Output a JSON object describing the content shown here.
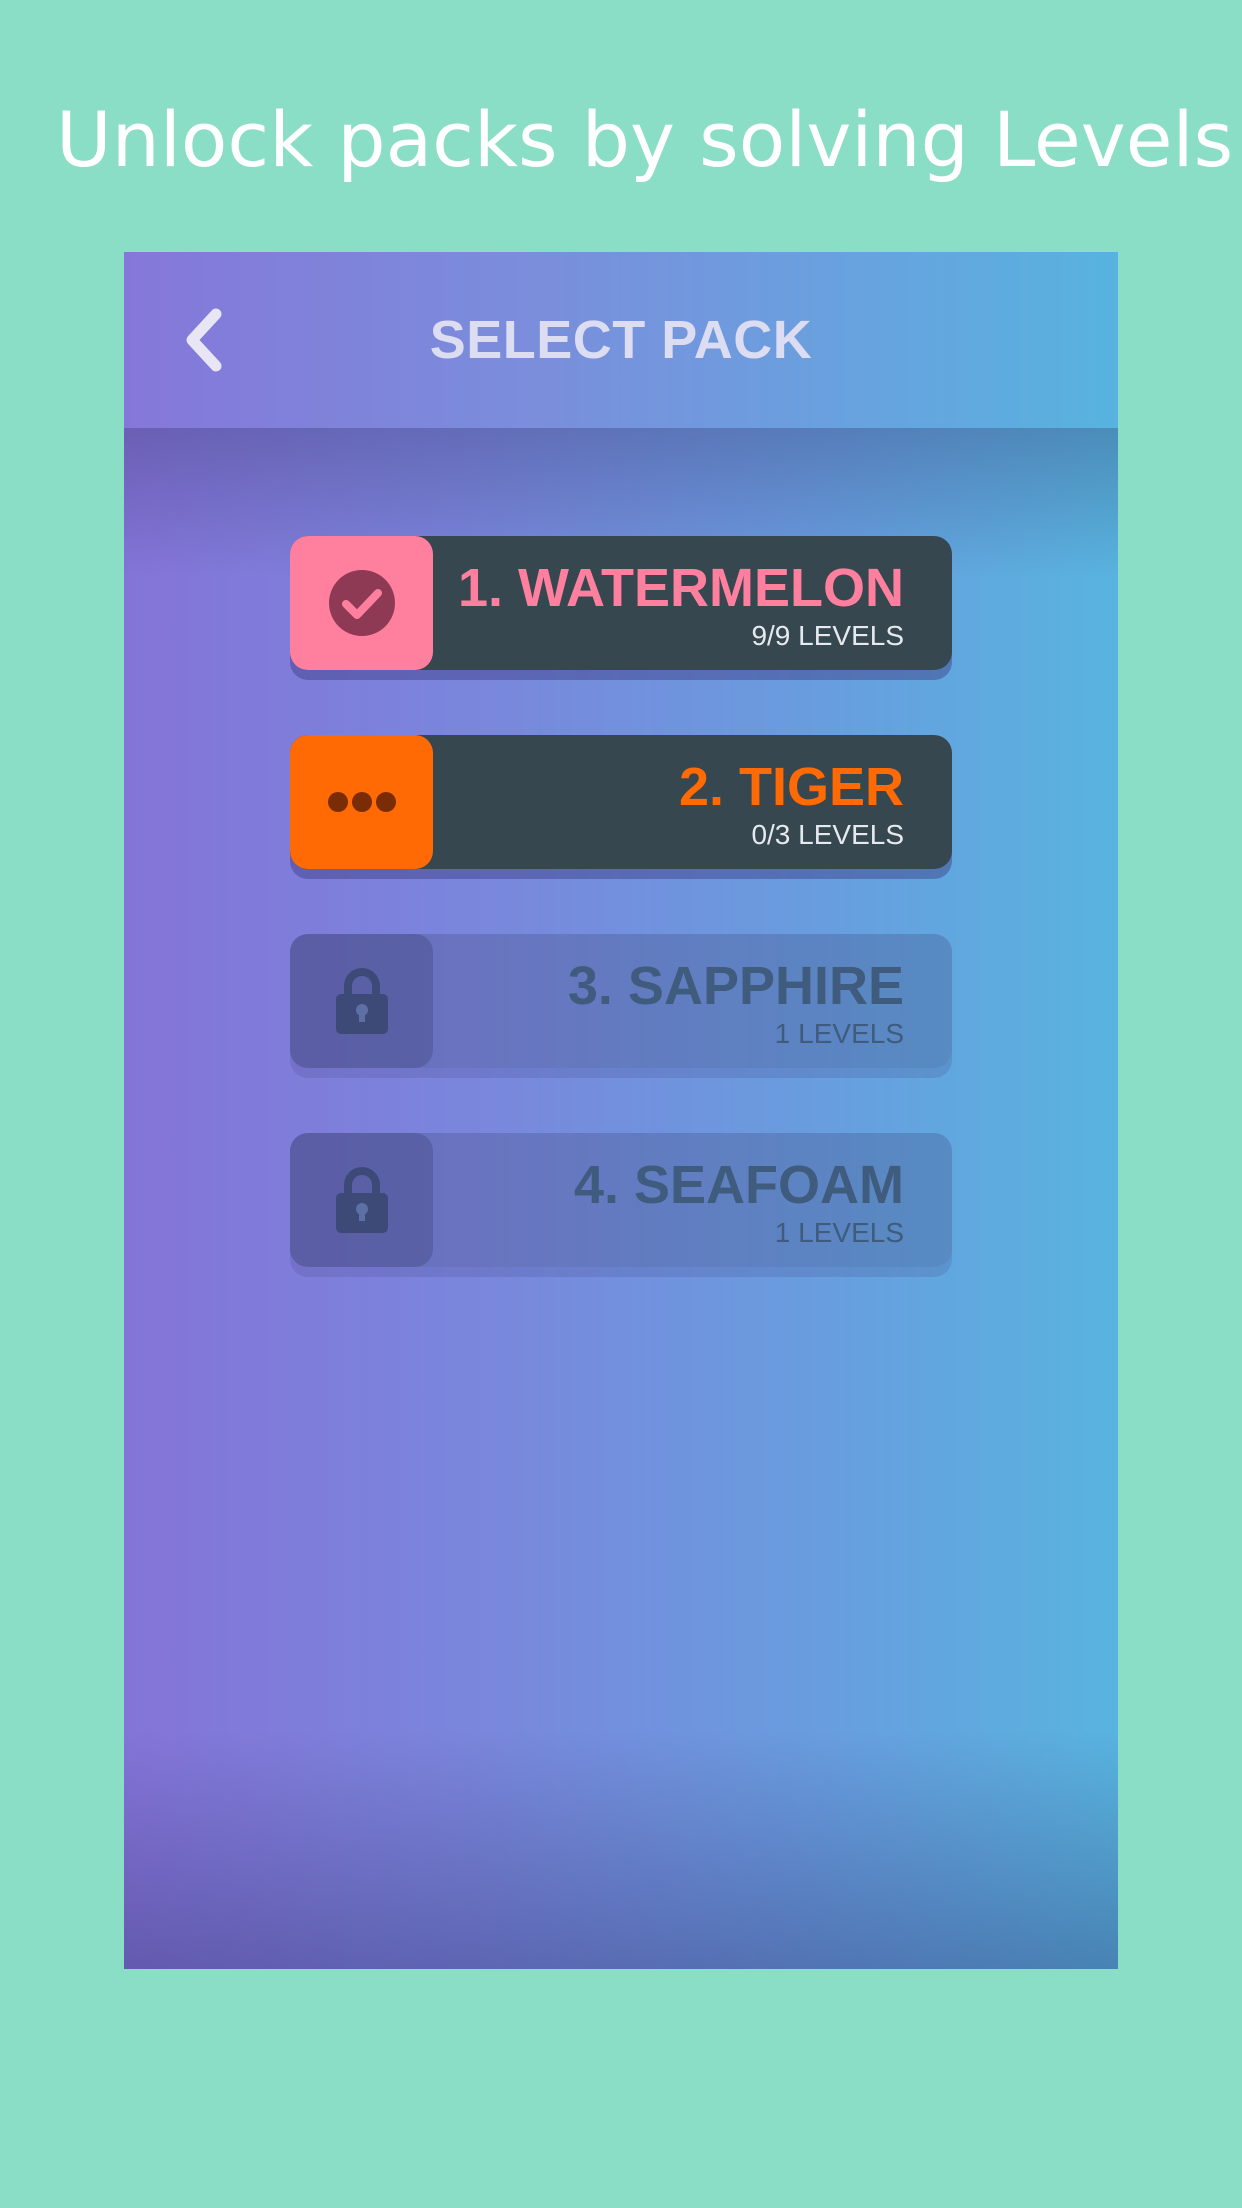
{
  "promo": {
    "text": "Unlock packs by solving Levels!"
  },
  "header": {
    "title": "SELECT PACK",
    "back_icon": "chevron-left-icon"
  },
  "colors": {
    "background": "#8adec6",
    "watermelon": "#ff7f9f",
    "tiger": "#ff6a04",
    "card_dark": "#37474f",
    "locked_text": "#3f5b7e"
  },
  "packs": [
    {
      "title": "1. WATERMELON",
      "levels": "9/9 LEVELS",
      "status": "completed",
      "icon": "check-icon"
    },
    {
      "title": "2. TIGER",
      "levels": "0/3 LEVELS",
      "status": "in-progress",
      "icon": "ellipsis-icon"
    },
    {
      "title": "3. SAPPHIRE",
      "levels": "1 LEVELS",
      "status": "locked",
      "icon": "lock-icon"
    },
    {
      "title": "4. SEAFOAM",
      "levels": "1 LEVELS",
      "status": "locked",
      "icon": "lock-icon"
    }
  ]
}
